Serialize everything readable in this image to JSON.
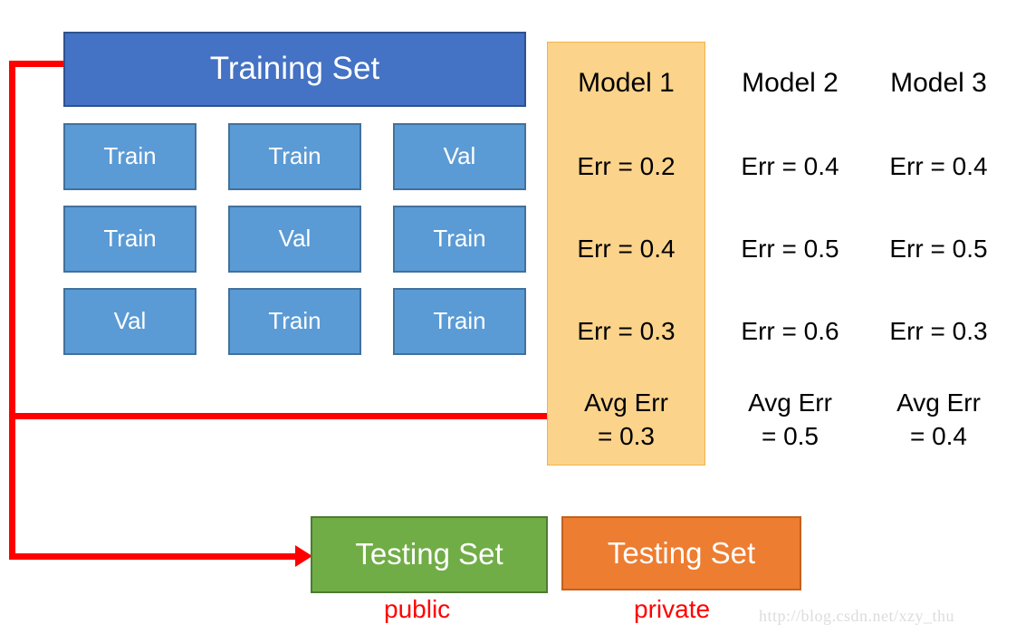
{
  "diagram": {
    "title_box": {
      "label": "Training Set"
    },
    "folds": {
      "rows": [
        [
          "Train",
          "Train",
          "Val"
        ],
        [
          "Train",
          "Val",
          "Train"
        ],
        [
          "Val",
          "Train",
          "Train"
        ]
      ]
    },
    "models": [
      {
        "title": "Model 1",
        "errors": [
          "Err = 0.2",
          "Err = 0.4",
          "Err = 0.3"
        ],
        "avg_label": "Avg Err",
        "avg_value": "= 0.3",
        "highlighted": true
      },
      {
        "title": "Model 2",
        "errors": [
          "Err = 0.4",
          "Err = 0.5",
          "Err = 0.6"
        ],
        "avg_label": "Avg Err",
        "avg_value": "= 0.5",
        "highlighted": false
      },
      {
        "title": "Model 3",
        "errors": [
          "Err = 0.4",
          "Err = 0.5",
          "Err = 0.3"
        ],
        "avg_label": "Avg Err",
        "avg_value": "= 0.4",
        "highlighted": false
      }
    ],
    "testing": {
      "public_box": "Testing Set",
      "public_caption": "public",
      "private_box": "Testing Set",
      "private_caption": "private"
    },
    "watermark": "http://blog.csdn.net/xzy_thu",
    "colors": {
      "training_set": "#4472C4",
      "fold_cell": "#5B9BD5",
      "highlight": "#FBD38B",
      "testing_public": "#70AD47",
      "testing_private": "#ED7D31",
      "connector": "#FF0000",
      "caption": "#FF0000",
      "watermark": "#DCDCDC"
    }
  }
}
